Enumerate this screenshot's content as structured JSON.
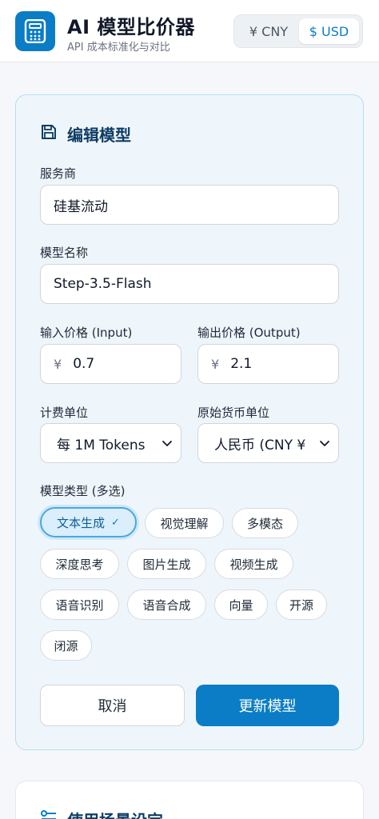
{
  "header": {
    "title": "AI 模型比价器",
    "subtitle": "API 成本标准化与对比",
    "currency_options": [
      "¥ CNY",
      "$ USD"
    ],
    "currency_selected": "$ USD"
  },
  "edit_form": {
    "title": "编辑模型",
    "provider_label": "服务商",
    "provider_value": "硅基流动",
    "model_name_label": "模型名称",
    "model_name_value": "Step-3.5-Flash",
    "input_price_label": "输入价格 (Input)",
    "input_price_value": "0.7",
    "output_price_label": "输出价格 (Output)",
    "output_price_value": "2.1",
    "currency_symbol": "¥",
    "billing_unit_label": "计费单位",
    "billing_unit_value": "每 1M Tokens",
    "original_currency_label": "原始货币单位",
    "original_currency_value": "人民币 (CNY ¥",
    "model_type_label": "模型类型 (多选)",
    "model_types": [
      {
        "label": "文本生成",
        "selected": true
      },
      {
        "label": "视觉理解",
        "selected": false
      },
      {
        "label": "多模态",
        "selected": false
      },
      {
        "label": "深度思考",
        "selected": false
      },
      {
        "label": "图片生成",
        "selected": false
      },
      {
        "label": "视频生成",
        "selected": false
      },
      {
        "label": "语音识别",
        "selected": false
      },
      {
        "label": "语音合成",
        "selected": false
      },
      {
        "label": "向量",
        "selected": false
      },
      {
        "label": "开源",
        "selected": false
      },
      {
        "label": "闭源",
        "selected": false
      }
    ],
    "cancel_label": "取消",
    "submit_label": "更新模型"
  },
  "usage_section": {
    "title": "使用场景设定"
  },
  "colors": {
    "accent": "#0b7dc6",
    "card_bg": "#eef6fc",
    "card_border": "#b9dcf0"
  },
  "icons": {
    "logo": "calculator-icon",
    "form_title": "save-icon",
    "usage_title": "sliders-icon"
  }
}
